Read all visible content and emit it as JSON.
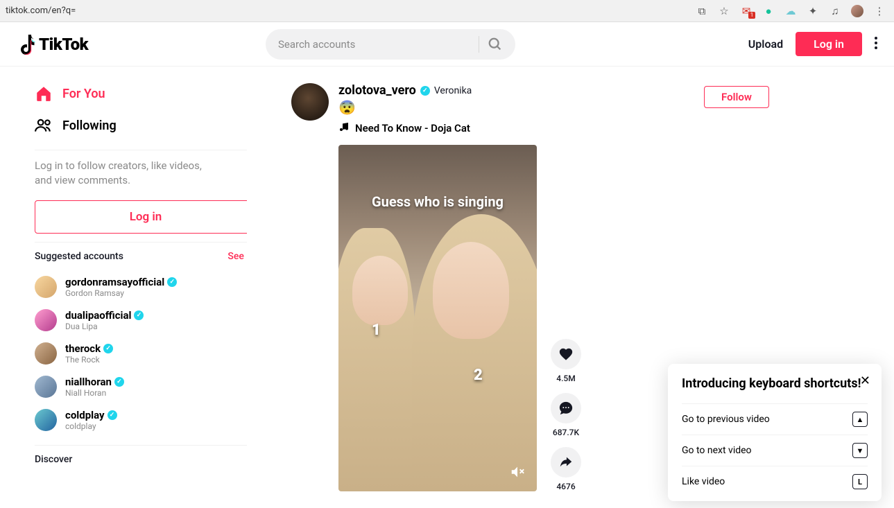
{
  "browser": {
    "url": "tiktok.com/en?q="
  },
  "header": {
    "logo_text": "TikTok",
    "search_placeholder": "Search accounts",
    "upload_label": "Upload",
    "login_label": "Log in"
  },
  "sidebar": {
    "nav": {
      "for_you": "For You",
      "following": "Following"
    },
    "login_prompt": "Log in to follow creators, like videos, and view comments.",
    "login_button": "Log in",
    "suggested_title": "Suggested accounts",
    "see_all": "See all",
    "accounts": [
      {
        "handle": "gordonramsayofficial",
        "name": "Gordon Ramsay",
        "verified": true
      },
      {
        "handle": "dualipaofficial",
        "name": "Dua Lipa",
        "verified": true
      },
      {
        "handle": "therock",
        "name": "The Rock",
        "verified": true
      },
      {
        "handle": "niallhoran",
        "name": "Niall Horan",
        "verified": true
      },
      {
        "handle": "coldplay",
        "name": "coldplay",
        "verified": true
      }
    ],
    "discover_title": "Discover"
  },
  "post": {
    "handle": "zolotova_vero",
    "display_name": "Veronika",
    "caption": "😨",
    "music": "Need To Know - Doja Cat",
    "follow_label": "Follow",
    "video_text": "Guess who is singing",
    "num1": "1",
    "num2": "2",
    "likes": "4.5M",
    "comments": "687.7K",
    "shares": "4676"
  },
  "shortcuts": {
    "title": "Introducing keyboard shortcuts!",
    "items": [
      {
        "label": "Go to previous video",
        "key": "▲"
      },
      {
        "label": "Go to next video",
        "key": "▼"
      },
      {
        "label": "Like video",
        "key": "L"
      }
    ]
  }
}
